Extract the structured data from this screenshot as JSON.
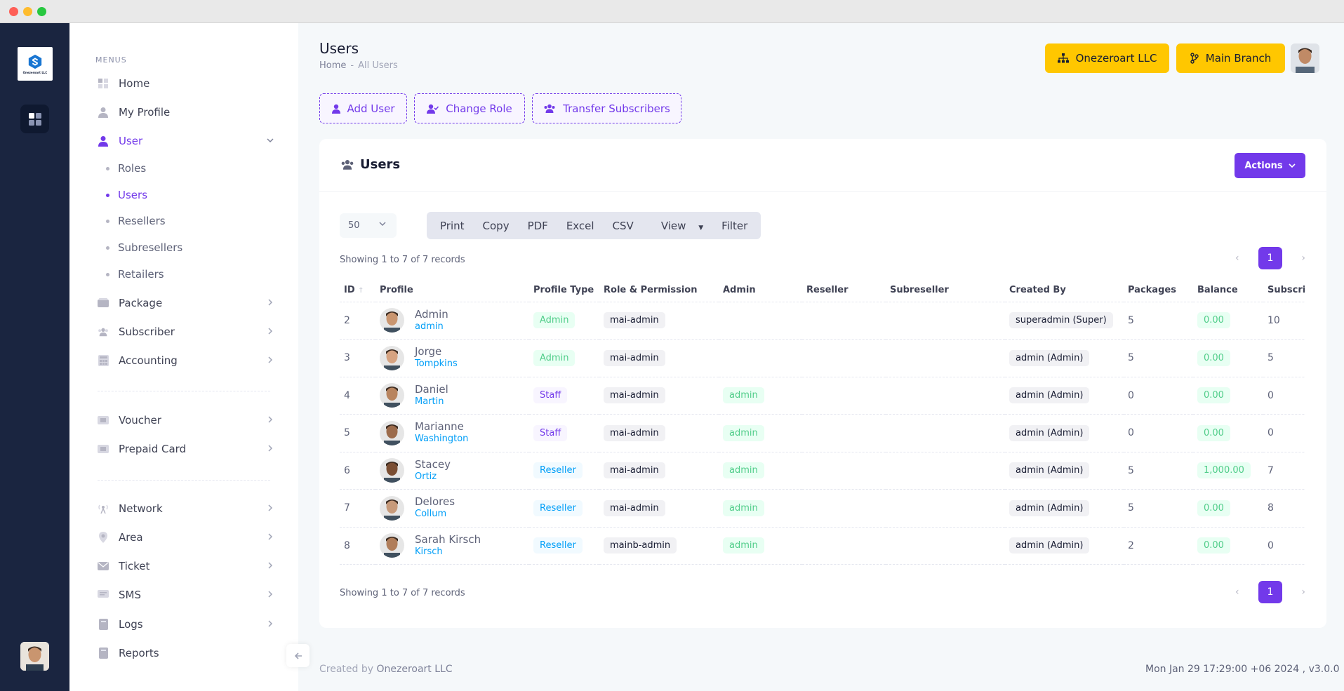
{
  "brand": {
    "logo_text": "Onezeroart LLC"
  },
  "menu": {
    "section_title": "MENUS",
    "items": [
      {
        "label": "Home",
        "icon": "home-grid-icon"
      },
      {
        "label": "My Profile",
        "icon": "person-icon"
      },
      {
        "label": "User",
        "icon": "person-icon"
      },
      {
        "label": "Package",
        "icon": "package-icon"
      },
      {
        "label": "Subscriber",
        "icon": "people-icon"
      },
      {
        "label": "Accounting",
        "icon": "calculator-icon"
      },
      {
        "label": "Voucher",
        "icon": "voucher-icon"
      },
      {
        "label": "Prepaid Card",
        "icon": "card-icon"
      },
      {
        "label": "Network",
        "icon": "network-icon"
      },
      {
        "label": "Area",
        "icon": "map-pin-icon"
      },
      {
        "label": "Ticket",
        "icon": "envelope-icon"
      },
      {
        "label": "SMS",
        "icon": "sms-icon"
      },
      {
        "label": "Logs",
        "icon": "book-icon"
      },
      {
        "label": "Reports",
        "icon": "book-icon"
      }
    ],
    "user_sub": [
      "Roles",
      "Users",
      "Resellers",
      "Subresellers",
      "Retailers"
    ]
  },
  "header": {
    "title": "Users",
    "breadcrumb_home": "Home",
    "breadcrumb_sep": "-",
    "breadcrumb_current": "All Users",
    "company_button": "Onezeroart LLC",
    "branch_button": "Main Branch"
  },
  "action_buttons": {
    "add_user": "Add User",
    "change_role": "Change Role",
    "transfer": "Transfer Subscribers"
  },
  "card": {
    "title": "Users",
    "actions_label": "Actions",
    "page_length": "50",
    "export_buttons": [
      "Print",
      "Copy",
      "PDF",
      "Excel",
      "CSV",
      "View",
      "Filter"
    ],
    "showing_text": "Showing 1 to 7 of 7 records",
    "current_page": "1"
  },
  "table": {
    "columns": [
      "ID",
      "Profile",
      "Profile Type",
      "Role & Permission",
      "Admin",
      "Reseller",
      "Subreseller",
      "Created By",
      "Packages",
      "Balance",
      "Subscribers"
    ],
    "rows": [
      {
        "id": "2",
        "name": "Admin",
        "username": "admin",
        "type": "Admin",
        "type_style": "green",
        "role": "mai-admin",
        "admin": "",
        "reseller": "",
        "subreseller": "",
        "created_by": "superadmin (Super)",
        "packages": "5",
        "balance": "0.00",
        "subscribers": "10"
      },
      {
        "id": "3",
        "name": "Jorge",
        "username": "Tompkins",
        "type": "Admin",
        "type_style": "green",
        "role": "mai-admin",
        "admin": "",
        "reseller": "",
        "subreseller": "",
        "created_by": "admin (Admin)",
        "packages": "5",
        "balance": "0.00",
        "subscribers": "5"
      },
      {
        "id": "4",
        "name": "Daniel",
        "username": "Martin",
        "type": "Staff",
        "type_style": "purple",
        "role": "mai-admin",
        "admin": "admin",
        "reseller": "",
        "subreseller": "",
        "created_by": "admin (Admin)",
        "packages": "0",
        "balance": "0.00",
        "subscribers": "0"
      },
      {
        "id": "5",
        "name": "Marianne",
        "username": "Washington",
        "type": "Staff",
        "type_style": "purple",
        "role": "mai-admin",
        "admin": "admin",
        "reseller": "",
        "subreseller": "",
        "created_by": "admin (Admin)",
        "packages": "0",
        "balance": "0.00",
        "subscribers": "0"
      },
      {
        "id": "6",
        "name": "Stacey",
        "username": "Ortiz",
        "type": "Reseller",
        "type_style": "blue",
        "role": "mai-admin",
        "admin": "admin",
        "reseller": "",
        "subreseller": "",
        "created_by": "admin (Admin)",
        "packages": "5",
        "balance": "1,000.00",
        "subscribers": "7"
      },
      {
        "id": "7",
        "name": "Delores",
        "username": "Collum",
        "type": "Reseller",
        "type_style": "blue",
        "role": "mai-admin",
        "admin": "admin",
        "reseller": "",
        "subreseller": "",
        "created_by": "admin (Admin)",
        "packages": "5",
        "balance": "0.00",
        "subscribers": "8"
      },
      {
        "id": "8",
        "name": "Sarah Kirsch",
        "username": "Kirsch",
        "type": "Reseller",
        "type_style": "blue",
        "role": "mainb-admin",
        "admin": "admin",
        "reseller": "",
        "subreseller": "",
        "created_by": "admin (Admin)",
        "packages": "2",
        "balance": "0.00",
        "subscribers": "0"
      }
    ]
  },
  "footer": {
    "created_by_label": "Created by",
    "company": "Onezeroart LLC",
    "datetime_version": "Mon Jan 29 17:29:00 +06 2024 ,   v3.0.0"
  },
  "colors": {
    "primary": "#7239ea",
    "warning": "#ffc700",
    "sidebar_dark": "#1a2540"
  }
}
